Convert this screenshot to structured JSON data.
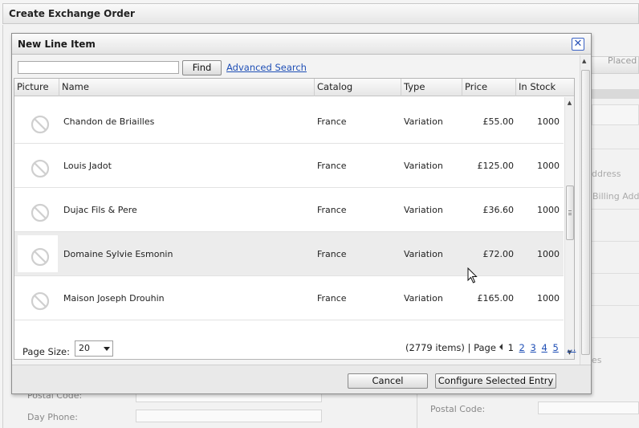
{
  "window": {
    "title": "Create Exchange Order"
  },
  "background": {
    "tab_label": "Placed I",
    "address_label": "ddress",
    "billing_label": "Billing Add",
    "es_label": "es",
    "postal_code_label_left": "Postal Code:",
    "day_phone_label": "Day Phone:",
    "postal_code_label_right": "Postal Code:"
  },
  "dialog": {
    "title": "New Line Item",
    "close_glyph": "✕",
    "search": {
      "value": "",
      "placeholder": ""
    },
    "find_label": "Find",
    "advanced_search_label": "Advanced Search",
    "columns": [
      "Picture",
      "Name",
      "Catalog",
      "Type",
      "Price",
      "In Stock"
    ],
    "rows": [
      {
        "name": "Chandon de Briailles",
        "catalog": "France",
        "type": "Variation",
        "price": "£55.00",
        "stock": "1000"
      },
      {
        "name": "Louis Jadot",
        "catalog": "France",
        "type": "Variation",
        "price": "£125.00",
        "stock": "1000"
      },
      {
        "name": "Dujac Fils & Pere",
        "catalog": "France",
        "type": "Variation",
        "price": "£36.60",
        "stock": "1000"
      },
      {
        "name": "Domaine Sylvie Esmonin",
        "catalog": "France",
        "type": "Variation",
        "price": "£72.00",
        "stock": "1000"
      },
      {
        "name": "Maison Joseph Drouhin",
        "catalog": "France",
        "type": "Variation",
        "price": "£165.00",
        "stock": "1000"
      }
    ],
    "pager": {
      "page_size_label": "Page Size:",
      "page_size_value": "20",
      "items_count": "(2779 items)",
      "separator": "|",
      "page_label": "Page",
      "current_page": "1",
      "pages": [
        "2",
        "3",
        "4",
        "5"
      ],
      "more": "..."
    },
    "cancel_label": "Cancel",
    "configure_label": "Configure Selected Entry"
  },
  "icons": {
    "no_image": "no-image-icon",
    "close": "close-icon"
  },
  "colors": {
    "link": "#1f4fb6",
    "close_border": "#3a62c4"
  }
}
